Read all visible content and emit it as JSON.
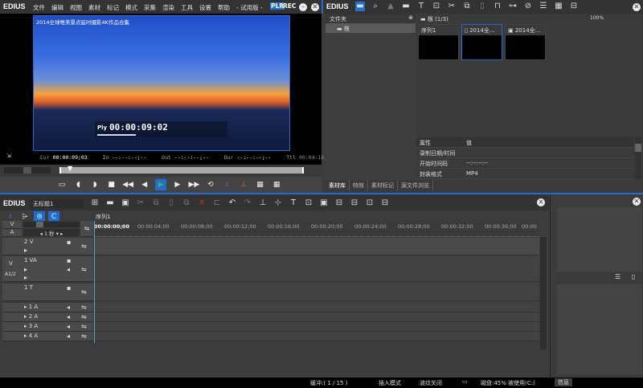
{
  "player": {
    "app": "EDIUS",
    "menu": [
      "文件",
      "编辑",
      "视图",
      "素材",
      "标记",
      "模式",
      "采集",
      "渲染",
      "工具",
      "设置",
      "帮助",
      "- 试用版 -"
    ],
    "plr": "PLR",
    "rec": "REC",
    "clip_title": "2014全球唯美景点延时摄影4K作品合集",
    "overlay_mode": "Ply",
    "overlay_tc": "00:00:09:02",
    "cur_label": "Cur",
    "cur": "00:00:09;03",
    "in_label": "In",
    "in": "--:--:--;--",
    "out_label": "Out",
    "out": "--:--:--;--",
    "dur_label": "Dur",
    "dur": "--:--:--;--",
    "ttl_label": "Ttl",
    "ttl": "00:04:16;06"
  },
  "bin": {
    "app": "EDIUS",
    "folder_header": "文件夹",
    "root": "根",
    "path": "根 (1/3)",
    "zoom": "100%",
    "clips": [
      {
        "name": "序列1"
      },
      {
        "name": "2014全..."
      },
      {
        "name": "2014全..."
      }
    ],
    "props": {
      "headers": [
        "属性",
        "值"
      ],
      "rows": [
        [
          "录制日期/时间",
          ""
        ],
        [
          "开始时间码",
          "--:--:--:--"
        ],
        [
          "封装格式",
          "MP4"
        ]
      ]
    },
    "tabs": [
      "素材库",
      "特效",
      "素材标记",
      "源文件浏览"
    ]
  },
  "timeline": {
    "app": "EDIUS",
    "project": "无标题1",
    "sequence_tab": "序列1",
    "scale": "1 秒",
    "ruler": [
      "00:00:00;00",
      "00:00:04;00",
      "00:00:08;00",
      "00:00:12;00",
      "00:00:16;00",
      "00:00:20;00",
      "00:00:24;00",
      "00:00:28;00",
      "00:00:32;00",
      "00:00:36;00",
      "00:00"
    ],
    "tracks": [
      "2 V",
      "1 VA",
      "1 T",
      "1 A",
      "2 A",
      "3 A",
      "4 A"
    ],
    "v_label": "V",
    "a_label": "A",
    "a12": "A1/2"
  },
  "info_panel": {
    "tab": "信息"
  },
  "status": {
    "buffer": "缓冲:( 1 / 15 )",
    "mode": "插入模式",
    "ripple": "波纹关闭",
    "disk": "磁盘:45% 被使用(C:)"
  },
  "colors": {
    "accent": "#1e6fd0",
    "play": "#3fb34f",
    "bg": "#3c3c3c"
  }
}
